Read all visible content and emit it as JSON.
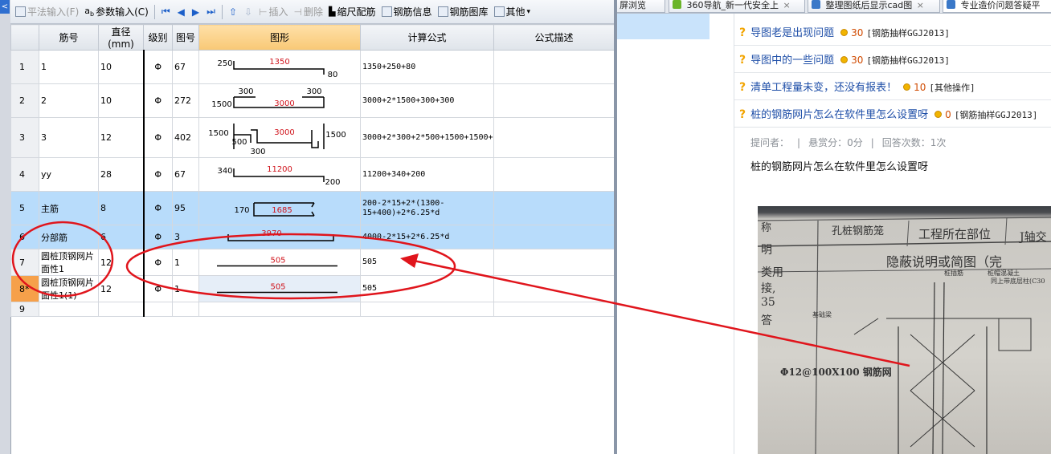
{
  "toolbar": {
    "items": [
      {
        "label": "平法输入(F)",
        "disabled": true
      },
      {
        "label": "参数输入(C)",
        "disabled": false
      },
      {
        "label": "插入",
        "disabled": true
      },
      {
        "label": "删除",
        "disabled": true
      },
      {
        "label": "缩尺配筋",
        "disabled": false
      },
      {
        "label": "钢筋信息",
        "disabled": false
      },
      {
        "label": "钢筋图库",
        "disabled": false
      },
      {
        "label": "其他",
        "disabled": false
      }
    ],
    "sidebar_tab": "<"
  },
  "grid": {
    "headers": [
      "",
      "筋号",
      "直径(mm)",
      "级别",
      "图号",
      "图形",
      "计算公式",
      "公式描述"
    ],
    "rows": [
      {
        "rownum": "1",
        "name": "1",
        "diameter": "10",
        "grade": "Φ",
        "fig": "67",
        "shape": {
          "type": "hook_both",
          "left": "250",
          "main": "1350",
          "right": "80"
        },
        "formula": "1350+250+80",
        "desc": "",
        "selected": false
      },
      {
        "rownum": "2",
        "name": "2",
        "diameter": "10",
        "grade": "Φ",
        "fig": "272",
        "shape": {
          "type": "u",
          "left": "1500",
          "top1": "300",
          "top2": "300",
          "main": "3000"
        },
        "formula": "3000+2*1500+300+300",
        "desc": "",
        "selected": false
      },
      {
        "rownum": "3",
        "name": "3",
        "diameter": "12",
        "grade": "Φ",
        "fig": "402",
        "shape": {
          "type": "complex",
          "left": "1500",
          "inner": "500",
          "bottom": "300",
          "main": "3000",
          "right": "1500"
        },
        "formula": "3000+2*300+2*500+1500+1500+2*6.25*d",
        "desc": "",
        "selected": false
      },
      {
        "rownum": "4",
        "name": "yy",
        "diameter": "28",
        "grade": "Φ",
        "fig": "67",
        "shape": {
          "type": "hook_both",
          "left": "340",
          "main": "11200",
          "right": "200"
        },
        "formula": "11200+340+200",
        "desc": "",
        "selected": false
      },
      {
        "rownum": "5",
        "name": "主筋",
        "diameter": "8",
        "grade": "Φ",
        "fig": "95",
        "shape": {
          "type": "rect",
          "left": "170",
          "main": "1685"
        },
        "formula": "200-2*15+2*(1300-15+400)+2*6.25*d",
        "desc": "",
        "selected": true
      },
      {
        "rownum": "6",
        "name": "分部筋",
        "diameter": "6",
        "grade": "Φ",
        "fig": "3",
        "shape": {
          "type": "hooks",
          "main": "3970"
        },
        "formula": "4000-2*15+2*6.25*d",
        "desc": "",
        "selected": true
      },
      {
        "rownum": "7",
        "name": "圆桩顶钢网片面性1",
        "diameter": "12",
        "grade": "Φ",
        "fig": "1",
        "shape": {
          "type": "straight",
          "main": "505"
        },
        "formula": "505",
        "desc": "",
        "selected": false
      },
      {
        "rownum": "8*",
        "name": "圆桩顶钢网片面性1(1)",
        "diameter": "12",
        "grade": "Φ",
        "fig": "1",
        "shape": {
          "type": "straight",
          "main": "505"
        },
        "formula": "505",
        "desc": "",
        "selected": false,
        "current": true
      },
      {
        "rownum": "9",
        "name": "",
        "diameter": "",
        "grade": "",
        "fig": "",
        "shape": {
          "type": "none",
          "main": ""
        },
        "formula": "",
        "desc": "",
        "selected": false
      }
    ]
  },
  "browser": {
    "tabs": [
      {
        "label": "屏浏览",
        "icon_color": "#ffffff"
      },
      {
        "label": "360导航_新一代安全上",
        "icon_color": "#6bb52a"
      },
      {
        "label": "整理图纸后显示cad图",
        "icon_color": "#3a78c8"
      },
      {
        "label": "专业造价问题答疑平",
        "icon_color": "#3a78c8"
      }
    ],
    "questions": [
      {
        "title": "导图老是出现问题",
        "score": "30",
        "category": "[钢筋抽样GGJ2013]"
      },
      {
        "title": "导图中的一些问题",
        "score": "30",
        "category": "[钢筋抽样GGJ2013]"
      },
      {
        "title": "清单工程量未变，还没有报表！",
        "score": "10",
        "category": "[其他操作]"
      },
      {
        "title": "桩的钢筋网片怎么在软件里怎么设置呀",
        "score": "0",
        "category": "[钢筋抽样GGJ2013]"
      }
    ],
    "detail": {
      "asker_label": "提问者：",
      "bounty": "悬赏分：0分",
      "answers": "回答次数：1次",
      "body": "桩的钢筋网片怎么在软件里怎么设置呀"
    },
    "photo": {
      "header1": "孔桩钢筋笼",
      "header2": "工程所在部位",
      "header3": "J轴交",
      "subtitle": "隐蔽说明或简图（完",
      "left_a": "称",
      "left_b": "明",
      "left_c": "类用",
      "left_d": "接,",
      "left_e": "35",
      "left_f": "答",
      "label_a": "桩插筋",
      "label_b": "桩帽混凝土",
      "label_c": "同上带底层柱(C30",
      "label_d": "基础梁",
      "mesh_label": "Φ12@100X100 钢筋网"
    }
  },
  "annotations": {
    "color": "#e0151c"
  }
}
